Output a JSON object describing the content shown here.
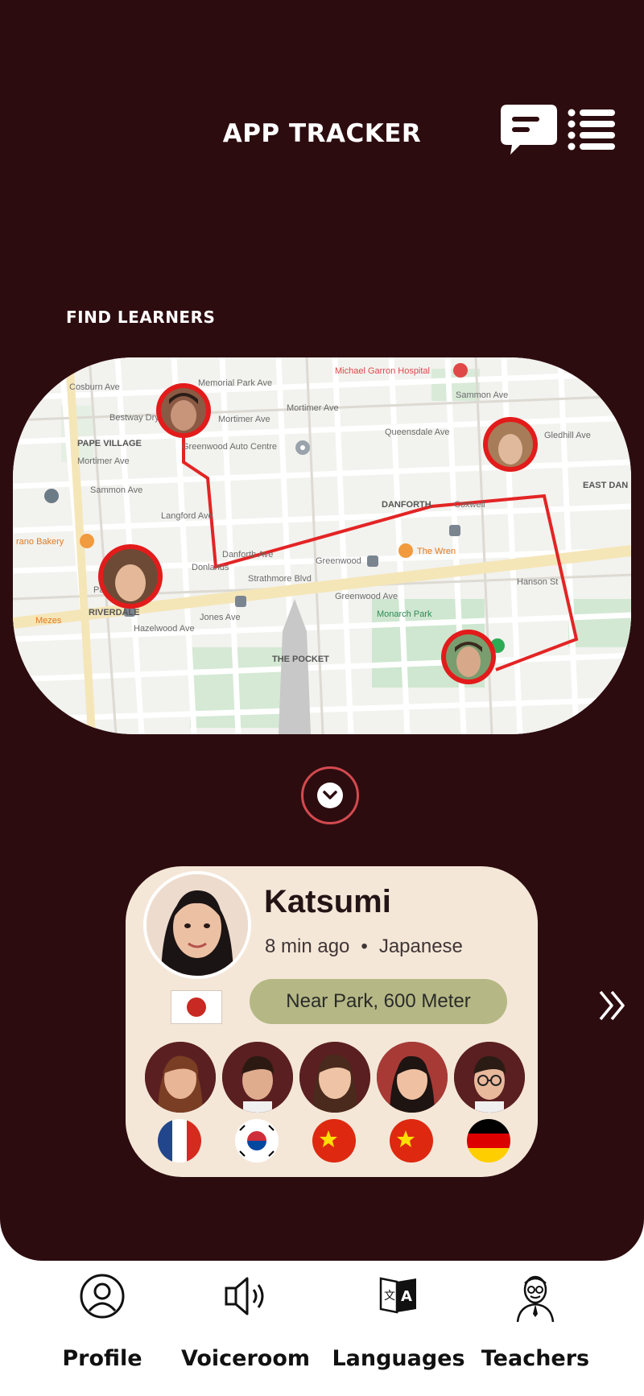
{
  "header": {
    "title": "APP TRACKER",
    "chat_icon": "chat-bubble-icon",
    "menu_icon": "list-menu-icon"
  },
  "map_section": {
    "label": "FIND LEARNERS",
    "map_labels": {
      "hospital": "Michael Garron Hospital",
      "coxburn": "Cosburn Ave",
      "memorial": "Memorial Park Ave",
      "mortimer1": "Mortimer Ave",
      "mortimer2": "Mortimer Ave",
      "mortimer3": "Mortimer Ave",
      "bestway": "Bestway Dry Cl",
      "pape_village": "PAPE VILLAGE",
      "greenwood_auto": "Greenwood Auto Centre",
      "queensdale": "Queensdale Ave",
      "sammon1": "Sammon Ave",
      "sammon2": "Sammon Ave",
      "east_danforth": "EAST DAN",
      "danforth": "DANFORTH",
      "coxwell": "Coxwell",
      "bakery": "rano Bakery",
      "the_wren": "The Wren",
      "greenwood": "Greenwood",
      "strathmore": "Strathmore Blvd",
      "riverdale": "RIVERDALE",
      "pape": "Pape",
      "donlands": "Donlands",
      "danforth_ave": "Danforth Ave",
      "the_pocket": "THE POCKET",
      "monarch_park": "Monarch Park",
      "mezes": "Mezes",
      "hazelwood": "Hazelwood Ave",
      "langford": "Langford Ave",
      "greenwood_ave": "Greenwood Ave",
      "jones": "Jones Ave",
      "gledhill": "Gledhill Ave",
      "hanson": "Hanson St"
    },
    "expand_icon": "chevron-down-icon"
  },
  "learner_card": {
    "name": "Katsumi",
    "time_ago": "8 min ago",
    "separator": "•",
    "language": "Japanese",
    "location": "Near Park, 600 Meter",
    "country_flag": "japan-flag-icon",
    "other_learners": [
      {
        "avatar": "learner-avatar-1",
        "flag": "france"
      },
      {
        "avatar": "learner-avatar-2",
        "flag": "south-korea"
      },
      {
        "avatar": "learner-avatar-3",
        "flag": "china"
      },
      {
        "avatar": "learner-avatar-4",
        "flag": "china"
      },
      {
        "avatar": "learner-avatar-5",
        "flag": "germany"
      }
    ]
  },
  "next_icon": "double-chevron-right-icon",
  "bottom_nav": {
    "profile": "Profile",
    "voiceroom": "Voiceroom",
    "languages": "Languages",
    "teachers": "Teachers"
  },
  "colors": {
    "background": "#2d0c0f",
    "accent": "#d34a4f",
    "card": "#f5e7d8",
    "pill": "#b5b884"
  }
}
